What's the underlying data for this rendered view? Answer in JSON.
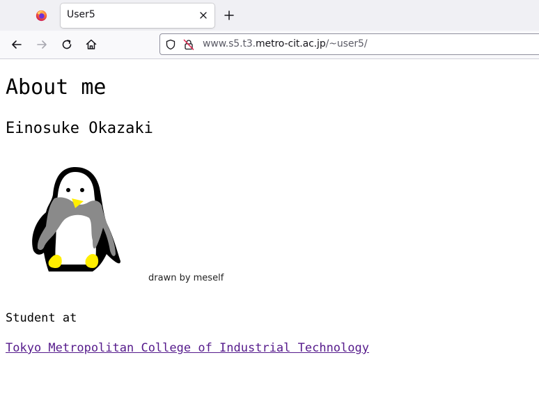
{
  "browser": {
    "tab_title": "User5",
    "url_prefix": "www.s5.t3.",
    "url_host": "metro-cit.ac.jp",
    "url_path": "/~user5/",
    "icons": [
      "firefox-logo-icon",
      "close-icon",
      "plus-icon",
      "back-arrow-icon",
      "forward-arrow-icon",
      "reload-icon",
      "home-icon",
      "shield-icon",
      "insecure-lock-icon"
    ]
  },
  "page": {
    "heading": "About me",
    "name": "Einosuke Okazaki",
    "image_caption": "drawn by meself",
    "student_label": "Student at",
    "school_link": "Tokyo Metropolitan College of Industrial Technology",
    "colors": {
      "visited_link": "#551a8b"
    }
  }
}
